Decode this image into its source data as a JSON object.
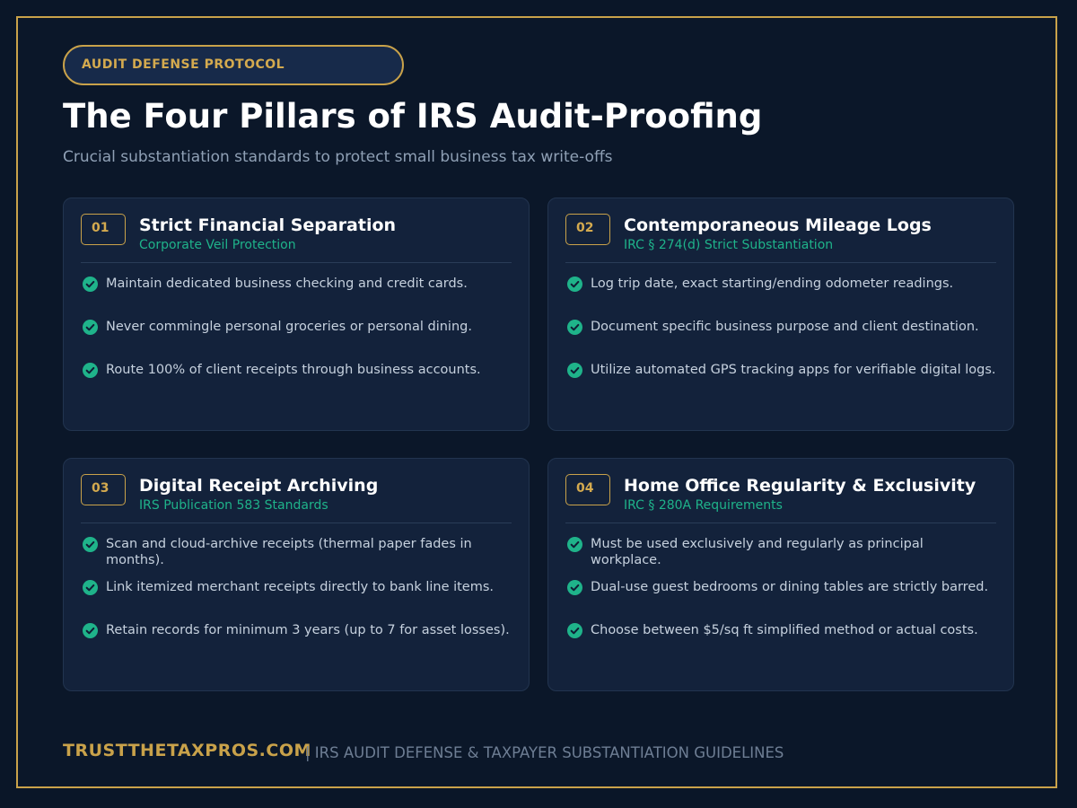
{
  "header": {
    "badge": "AUDIT DEFENSE PROTOCOL",
    "title": "The Four Pillars of IRS Audit-Proofing",
    "subtitle": "Crucial substantiation standards to protect small business tax write-offs"
  },
  "cards": [
    {
      "number": "01",
      "title": "Strict Financial Separation",
      "subtitle": "Corporate Veil Protection",
      "items": [
        "Maintain dedicated business checking and credit cards.",
        "Never commingle personal groceries or personal dining.",
        "Route 100% of client receipts through business accounts."
      ]
    },
    {
      "number": "02",
      "title": "Contemporaneous Mileage Logs",
      "subtitle": "IRC § 274(d) Strict Substantiation",
      "items": [
        "Log trip date, exact starting/ending odometer readings.",
        "Document specific business purpose and client destination.",
        "Utilize automated GPS tracking apps for verifiable digital logs."
      ]
    },
    {
      "number": "03",
      "title": "Digital Receipt Archiving",
      "subtitle": "IRS Publication 583 Standards",
      "items": [
        "Scan and cloud-archive receipts (thermal paper fades in months).",
        "Link itemized merchant receipts directly to bank line items.",
        "Retain records for minimum 3 years (up to 7 for asset losses)."
      ]
    },
    {
      "number": "04",
      "title": "Home Office Regularity & Exclusivity",
      "subtitle": "IRC § 280A Requirements",
      "items": [
        "Must be used exclusively and regularly as principal workplace.",
        "Dual-use guest bedrooms or dining tables are strictly barred.",
        "Choose between $5/sq ft simplified method or actual costs."
      ]
    }
  ],
  "footer": {
    "brand": "TRUSTTHETAXPROS.COM",
    "text": "| IRS AUDIT DEFENSE & TAXPAYER SUBSTANTIATION GUIDELINES"
  },
  "icons": {
    "check": "check-circle-icon"
  },
  "colors": {
    "background": "#0b1729",
    "accent_gold": "#c9a24a",
    "accent_green": "#1fb38a",
    "card": "#13223b"
  }
}
